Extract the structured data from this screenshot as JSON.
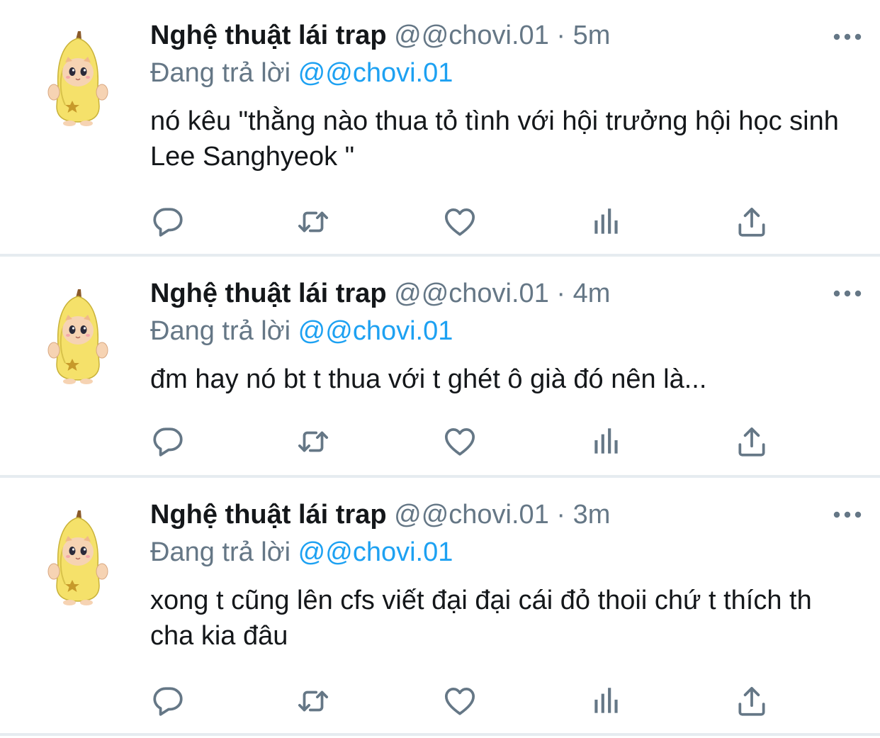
{
  "tweets": [
    {
      "name": "Nghệ thuật lái trap",
      "handle": "@@chovi.01",
      "time": "5m",
      "replying_prefix": "Đang trả lời",
      "replying_to": "@@chovi.01",
      "text": "nó kêu \"thằng nào thua tỏ tình với hội trưởng hội học sinh Lee Sanghyeok \""
    },
    {
      "name": "Nghệ thuật lái trap",
      "handle": "@@chovi.01",
      "time": "4m",
      "replying_prefix": "Đang trả lời",
      "replying_to": "@@chovi.01",
      "text": "đm hay nó bt t thua với t ghét ô già đó nên là..."
    },
    {
      "name": "Nghệ thuật lái trap",
      "handle": "@@chovi.01",
      "time": "3m",
      "replying_prefix": "Đang trả lời",
      "replying_to": "@@chovi.01",
      "text": "xong t cũng lên cfs viết đại đại cái đỏ thoii chứ t thích th cha kia đâu"
    }
  ],
  "separator": "·",
  "icons": [
    "reply-icon",
    "retweet-icon",
    "like-icon",
    "analytics-icon",
    "share-icon",
    "more-icon"
  ],
  "colors": {
    "name": "#14171a",
    "muted": "#657786",
    "mention": "#1da1f2",
    "divider": "#e6ecf0"
  }
}
